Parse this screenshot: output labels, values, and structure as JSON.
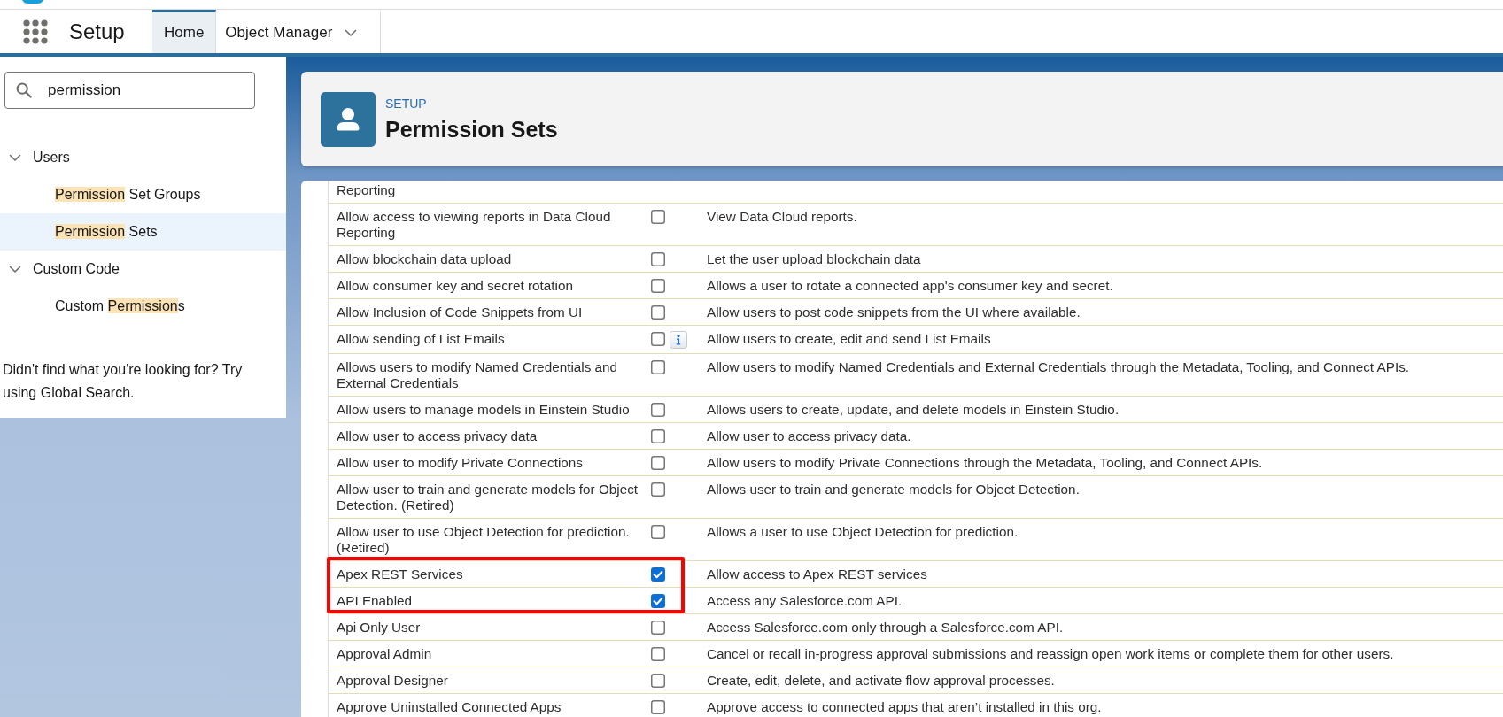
{
  "nav": {
    "app_name": "Setup",
    "tabs": [
      {
        "label": "Home",
        "selected": true,
        "dropdown": false
      },
      {
        "label": "Object Manager",
        "selected": false,
        "dropdown": true
      }
    ]
  },
  "sidebar": {
    "search": {
      "value": "permission"
    },
    "tree": [
      {
        "parts": [
          {
            "text": "Users",
            "match": false
          }
        ],
        "expanded": true,
        "children": [
          {
            "parts": [
              {
                "text": "Permission",
                "match": true
              },
              {
                "text": " Set Groups",
                "match": false
              }
            ],
            "selected": false
          },
          {
            "parts": [
              {
                "text": "Permission",
                "match": true
              },
              {
                "text": " Sets",
                "match": false
              }
            ],
            "selected": true
          }
        ]
      },
      {
        "parts": [
          {
            "text": "Custom Code",
            "match": false
          }
        ],
        "expanded": true,
        "children": [
          {
            "parts": [
              {
                "text": "Custom ",
                "match": false
              },
              {
                "text": "Permission",
                "match": true
              },
              {
                "text": "s",
                "match": false
              }
            ],
            "selected": false
          }
        ]
      }
    ],
    "footer": "Didn't find what you're looking for? Try using Global Search."
  },
  "header": {
    "eyebrow": "SETUP",
    "title": "Permission Sets"
  },
  "table": {
    "rows": [
      {
        "kind": "continuation",
        "name": "Reporting",
        "highlighted": false
      },
      {
        "kind": "permission",
        "name": "Allow access to viewing reports in Data Cloud Reporting",
        "checked": false,
        "info": false,
        "highlighted": false,
        "description": "View Data Cloud reports."
      },
      {
        "kind": "permission",
        "name": "Allow blockchain data upload",
        "checked": false,
        "info": false,
        "highlighted": false,
        "description": "Let the user upload blockchain data"
      },
      {
        "kind": "permission",
        "name": "Allow consumer key and secret rotation",
        "checked": false,
        "info": false,
        "highlighted": false,
        "description": "Allows a user to rotate a connected app's consumer key and secret."
      },
      {
        "kind": "permission",
        "name": "Allow Inclusion of Code Snippets from UI",
        "checked": false,
        "info": false,
        "highlighted": false,
        "description": "Allow users to post code snippets from the UI where available."
      },
      {
        "kind": "permission",
        "name": "Allow sending of List Emails",
        "checked": false,
        "info": true,
        "highlighted": false,
        "description": "Allow users to create, edit and send List Emails"
      },
      {
        "kind": "permission",
        "name": "Allows users to modify Named Credentials and External Credentials",
        "checked": false,
        "info": false,
        "highlighted": false,
        "description": "Allow users to modify Named Credentials and External Credentials through the Metadata, Tooling, and Connect APIs."
      },
      {
        "kind": "permission",
        "name": "Allow users to manage models in Einstein Studio",
        "checked": false,
        "info": false,
        "highlighted": false,
        "description": "Allows users to create, update, and delete models in Einstein Studio."
      },
      {
        "kind": "permission",
        "name": "Allow user to access privacy data",
        "checked": false,
        "info": false,
        "highlighted": false,
        "description": "Allow user to access privacy data."
      },
      {
        "kind": "permission",
        "name": "Allow user to modify Private Connections",
        "checked": false,
        "info": false,
        "highlighted": false,
        "description": "Allow users to modify Private Connections through the Metadata, Tooling, and Connect APIs."
      },
      {
        "kind": "permission",
        "name": "Allow user to train and generate models for Object Detection. (Retired)",
        "checked": false,
        "info": false,
        "highlighted": false,
        "description": "Allows user to train and generate models for Object Detection."
      },
      {
        "kind": "permission",
        "name": "Allow user to use Object Detection for prediction. (Retired)",
        "checked": false,
        "info": false,
        "highlighted": false,
        "description": "Allows a user to use Object Detection for prediction."
      },
      {
        "kind": "permission",
        "name": "Apex REST Services",
        "checked": true,
        "info": false,
        "highlighted": true,
        "description": "Allow access to Apex REST services"
      },
      {
        "kind": "permission",
        "name": "API Enabled",
        "checked": true,
        "info": false,
        "highlighted": true,
        "description": "Access any Salesforce.com API."
      },
      {
        "kind": "permission",
        "name": "Api Only User",
        "checked": false,
        "info": false,
        "highlighted": false,
        "description": "Access Salesforce.com only through a Salesforce.com API."
      },
      {
        "kind": "permission",
        "name": "Approval Admin",
        "checked": false,
        "info": false,
        "highlighted": false,
        "description": "Cancel or recall in-progress approval submissions and reassign open work items or complete them for other users."
      },
      {
        "kind": "permission",
        "name": "Approval Designer",
        "checked": false,
        "info": false,
        "highlighted": false,
        "description": "Create, edit, delete, and activate flow approval processes."
      },
      {
        "kind": "permission",
        "name": "Approve Uninstalled Connected Apps",
        "checked": false,
        "info": false,
        "highlighted": false,
        "description": "Approve access to connected apps that aren’t installed in this org."
      }
    ]
  }
}
